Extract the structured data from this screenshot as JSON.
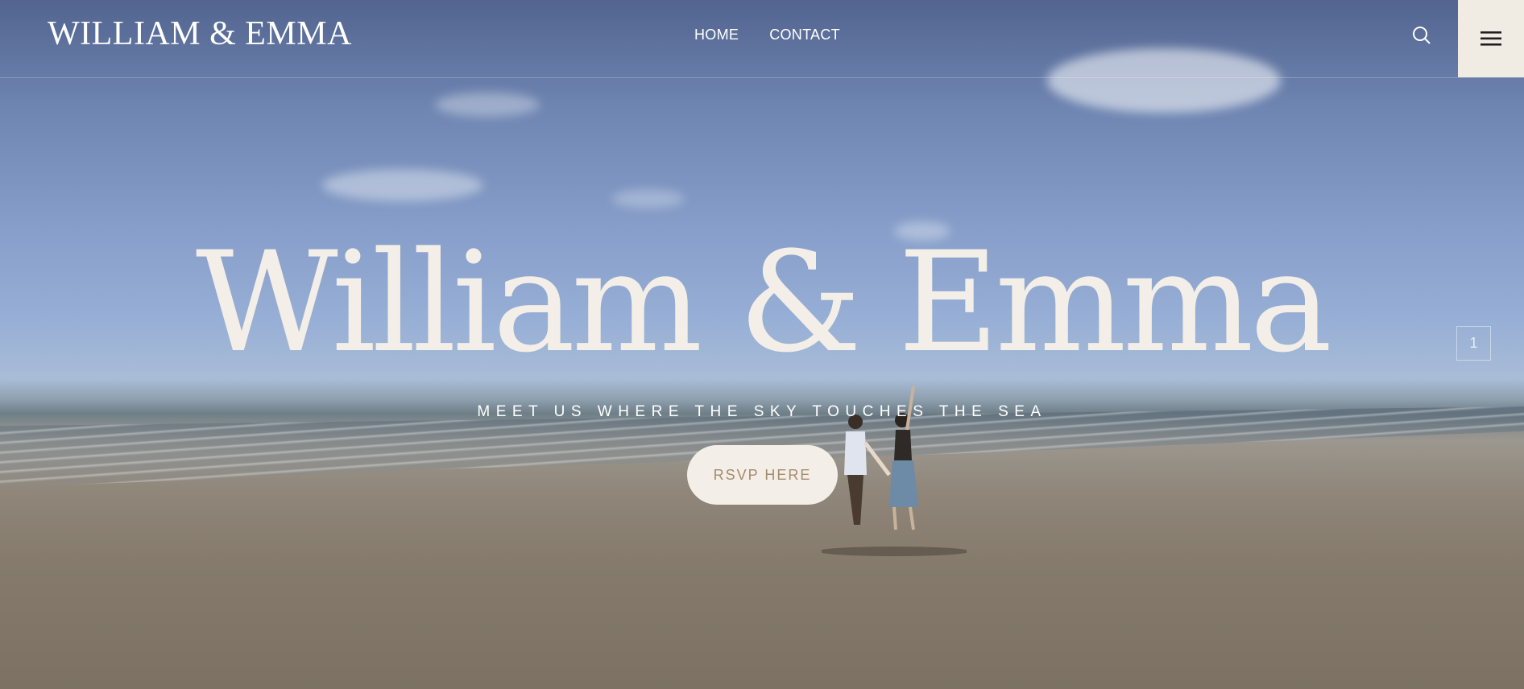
{
  "header": {
    "logo": "WILLIAM & EMMA",
    "nav": [
      {
        "label": "HOME"
      },
      {
        "label": "CONTACT"
      }
    ],
    "search_icon": "search-icon",
    "menu_icon": "hamburger-menu-icon"
  },
  "hero": {
    "title": "William & Emma",
    "tagline": "MEET US WHERE THE SKY TOUCHES THE SEA",
    "cta_label": "RSVP HERE",
    "slide_indicator": "1",
    "background_image": "beach-couple-photo"
  },
  "colors": {
    "cream": "#f3eee7",
    "cta_text": "#a58c6e",
    "sky": "#879fca",
    "sand": "#857a6c"
  }
}
